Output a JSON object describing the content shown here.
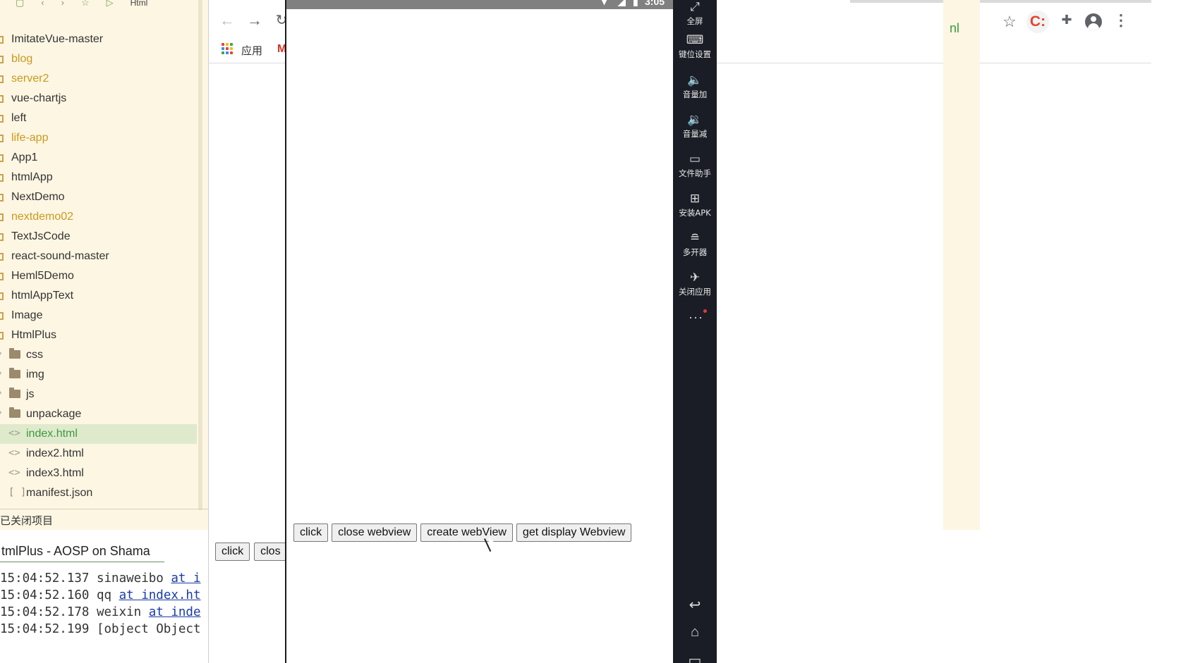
{
  "ide": {
    "breadcrumb": "Html",
    "tree": [
      {
        "label": "ImitateVue-master",
        "kind": "project"
      },
      {
        "label": "blog",
        "kind": "project-alt"
      },
      {
        "label": "server2",
        "kind": "project-alt"
      },
      {
        "label": "vue-chartjs",
        "kind": "project"
      },
      {
        "label": "left",
        "kind": "project"
      },
      {
        "label": "life-app",
        "kind": "project-alt"
      },
      {
        "label": "App1",
        "kind": "project"
      },
      {
        "label": "htmlApp",
        "kind": "project"
      },
      {
        "label": "NextDemo",
        "kind": "project"
      },
      {
        "label": "nextdemo02",
        "kind": "project-alt"
      },
      {
        "label": "TextJsCode",
        "kind": "project"
      },
      {
        "label": "react-sound-master",
        "kind": "project"
      },
      {
        "label": "Heml5Demo",
        "kind": "project"
      },
      {
        "label": "htmlAppText",
        "kind": "project"
      },
      {
        "label": "Image",
        "kind": "project"
      },
      {
        "label": "HtmlPlus",
        "kind": "project"
      },
      {
        "label": "css",
        "kind": "folder"
      },
      {
        "label": "img",
        "kind": "folder"
      },
      {
        "label": "js",
        "kind": "folder"
      },
      {
        "label": "unpackage",
        "kind": "folder"
      },
      {
        "label": "index.html",
        "kind": "file-selected"
      },
      {
        "label": "index2.html",
        "kind": "file"
      },
      {
        "label": "index3.html",
        "kind": "file"
      },
      {
        "label": "manifest.json",
        "kind": "json"
      }
    ],
    "closed_projects": "已关闭项目",
    "console_tab": "tmlPlus - AOSP on Shama",
    "console_lines": [
      {
        "time": "15:04:52.137",
        "text": "sinaweibo",
        "link": "at i"
      },
      {
        "time": "15:04:52.160",
        "text": "qq",
        "link": "at index.ht"
      },
      {
        "time": "15:04:52.178",
        "text": "weixin",
        "link": "at inde"
      },
      {
        "time": "15:04:52.199",
        "text": "[object Object",
        "link": ""
      }
    ]
  },
  "browser": {
    "bookmarks_apps_label": "应用",
    "gmail_glyph": "M",
    "extension_badge": "C:",
    "page_buttons": [
      "click",
      "clos"
    ],
    "right_strip_text": "nl",
    "apps_colors": [
      "#ea4335",
      "#fbbc05",
      "#34a853",
      "#4285f4",
      "#ea4335",
      "#fbbc05",
      "#34a853",
      "#4285f4",
      "#ea4335"
    ]
  },
  "emulator": {
    "status_time": "3:05",
    "buttons": [
      "click",
      "close webview",
      "create webView",
      "get display Webview"
    ]
  },
  "sidebar": {
    "items": [
      {
        "icon": "fullscreen-icon",
        "glyph": "⤢",
        "label": "全屏"
      },
      {
        "icon": "keymap-icon",
        "glyph": "⌨",
        "label": "键位设置"
      },
      {
        "icon": "volume-up-icon",
        "glyph": "🔈",
        "label": "音量加"
      },
      {
        "icon": "volume-down-icon",
        "glyph": "🔉",
        "label": "音量减"
      },
      {
        "icon": "file-assistant-icon",
        "glyph": "▭",
        "label": "文件助手"
      },
      {
        "icon": "install-apk-icon",
        "glyph": "⊞",
        "label": "安装APK"
      },
      {
        "icon": "multi-instance-icon",
        "glyph": "≘",
        "label": "多开器"
      },
      {
        "icon": "close-app-icon",
        "glyph": "✈",
        "label": "关闭应用"
      }
    ],
    "more_glyph": "···",
    "nav": [
      {
        "icon": "back-icon",
        "glyph": "↩"
      },
      {
        "icon": "home-icon",
        "glyph": "⌂"
      },
      {
        "icon": "recents-icon",
        "glyph": "▭"
      }
    ]
  },
  "colors": {
    "ide_bg": "#fdf6e3",
    "emulator_sidebar": "#1a1d25",
    "selected_file": "#3d9a3d",
    "status_bar": "#808080"
  }
}
